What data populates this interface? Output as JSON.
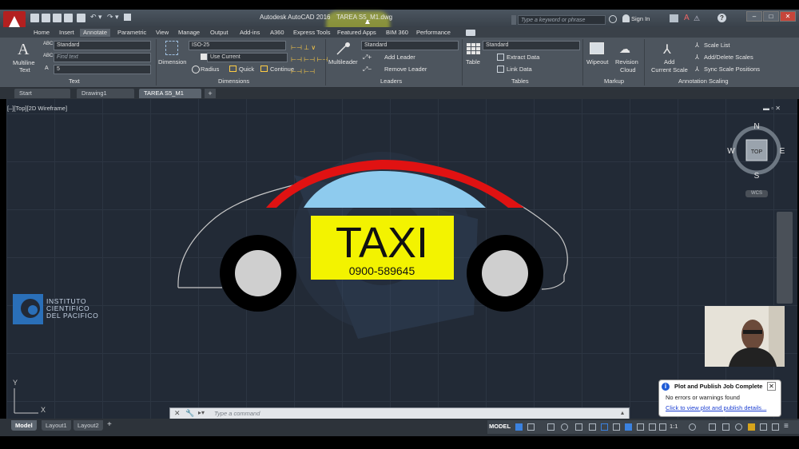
{
  "window": {
    "app_title": "Autodesk AutoCAD 2016",
    "file_name": "TAREA S5_M1.dwg",
    "search_placeholder": "Type a keyword or phrase",
    "sign_in": "Sign In",
    "help": "?"
  },
  "ribbon_tabs": [
    "Home",
    "Insert",
    "Annotate",
    "Parametric",
    "View",
    "Manage",
    "Output",
    "Add-ins",
    "A360",
    "Express Tools",
    "Featured Apps",
    "BIM 360",
    "Performance"
  ],
  "ribbon_active_tab": "Annotate",
  "ribbon": {
    "text_panel": {
      "multiline_text": "Multiline",
      "multiline_text2": "Text",
      "style_value": "Standard",
      "find_placeholder": "Find text",
      "height_value": "5",
      "label": "Text"
    },
    "dimensions_panel": {
      "dimension": "Dimension",
      "style_value": "ISO-25",
      "use_current": "Use Current",
      "radius": "Radius",
      "quick": "Quick",
      "continue": "Continue",
      "label": "Dimensions"
    },
    "leaders_panel": {
      "multileader": "Multileader",
      "style_value": "Standard",
      "add_leader": "Add Leader",
      "remove_leader": "Remove Leader",
      "label": "Leaders"
    },
    "tables_panel": {
      "table": "Table",
      "style_value": "Standard",
      "extract_data": "Extract Data",
      "link_data": "Link Data",
      "label": "Tables"
    },
    "markup_panel": {
      "wipeout": "Wipeout",
      "revision_cloud": "Revision",
      "revision_cloud2": "Cloud",
      "label": "Markup"
    },
    "annotation_scaling_panel": {
      "add_current_scale": "Add",
      "add_current_scale2": "Current Scale",
      "scale_list": "Scale List",
      "add_delete_scales": "Add/Delete Scales",
      "sync_scale_positions": "Sync Scale Positions",
      "label": "Annotation Scaling"
    }
  },
  "file_tabs": [
    "Start",
    "Drawing1",
    "TAREA S5_M1"
  ],
  "file_tab_active": "TAREA S5_M1",
  "viewport_label": "[–][Top][2D Wireframe]",
  "drawing": {
    "sign_text": "TAXI",
    "phone": "0900-589645",
    "colors": {
      "sign": "#f3f300",
      "window": "#8ecbee",
      "accent": "#e01212",
      "tire": "#000000",
      "hub": "#cfcfcf",
      "body_line": "#c8c8c8"
    }
  },
  "navcube": {
    "n": "N",
    "s": "S",
    "e": "E",
    "w": "W",
    "top": "TOP",
    "wcs": "WCS"
  },
  "logo": {
    "line1": "INSTITUTO",
    "line2": "CIENTIFICO",
    "line3": "DEL PACIFICO"
  },
  "notification": {
    "title": "Plot and Publish Job Complete",
    "body": "No errors or warnings found",
    "link": "Click to view plot and publish details..."
  },
  "command": {
    "placeholder": "Type a command"
  },
  "layout_tabs": [
    "Model",
    "Layout1",
    "Layout2"
  ],
  "layout_active": "Model",
  "status": {
    "model": "MODEL",
    "scale": "1:1"
  }
}
